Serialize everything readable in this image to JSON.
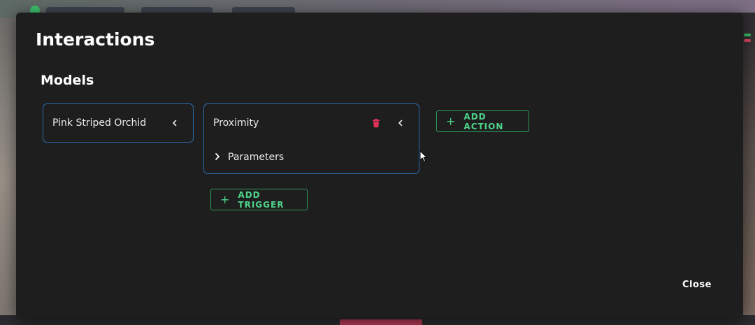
{
  "modal": {
    "title": "Interactions",
    "section_title": "Models",
    "model_card": {
      "label": "Pink Striped Orchid",
      "chevron_icon": "chevron-left-icon"
    },
    "trigger_card": {
      "label": "Proximity",
      "delete_icon": "trash-icon",
      "chevron_icon": "chevron-left-icon",
      "parameters_label": "Parameters",
      "parameters_icon": "chevron-right-icon"
    },
    "add_action_label": "ADD ACTION",
    "add_trigger_label": "ADD TRIGGER",
    "close_label": "Close"
  },
  "colors": {
    "modal_bg": "#1e1e1f",
    "card_border": "#2b6aa8",
    "accent_green": "#4fd48a",
    "delete_red": "#e0335a"
  }
}
